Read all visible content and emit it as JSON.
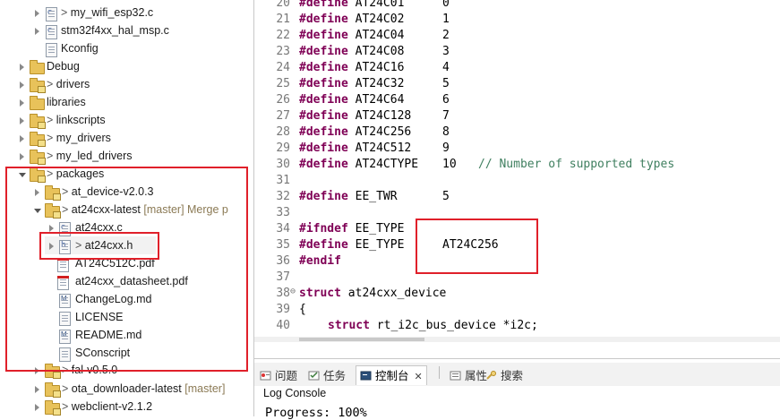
{
  "explorer": {
    "items": [
      {
        "label": "my_wifi_esp32.c",
        "prefix": "> "
      },
      {
        "label": "stm32f4xx_hal_msp.c",
        "prefix": ""
      },
      {
        "label": "Kconfig",
        "prefix": ""
      },
      {
        "label": "Debug",
        "prefix": ""
      },
      {
        "label": "drivers",
        "prefix": "> "
      },
      {
        "label": "libraries",
        "prefix": ""
      },
      {
        "label": "linkscripts",
        "prefix": "> "
      },
      {
        "label": "my_drivers",
        "prefix": "> "
      },
      {
        "label": "my_led_drivers",
        "prefix": "> "
      },
      {
        "label": "packages",
        "prefix": "> "
      },
      {
        "label": "at_device-v2.0.3",
        "prefix": "> "
      },
      {
        "label": "at24cxx-latest",
        "prefix": "> ",
        "branch": "[master] Merge p"
      },
      {
        "label": "at24cxx.c",
        "prefix": ""
      },
      {
        "label": "at24cxx.h",
        "prefix": "> "
      },
      {
        "label": "AT24C512C.pdf",
        "prefix": ""
      },
      {
        "label": "at24cxx_datasheet.pdf",
        "prefix": ""
      },
      {
        "label": "ChangeLog.md",
        "prefix": ""
      },
      {
        "label": "LICENSE",
        "prefix": ""
      },
      {
        "label": "README.md",
        "prefix": ""
      },
      {
        "label": "SConscript",
        "prefix": ""
      },
      {
        "label": "fal-v0.5.0",
        "prefix": "> "
      },
      {
        "label": "ota_downloader-latest",
        "prefix": "> ",
        "branch": "[master]"
      },
      {
        "label": "webclient-v2.1.2",
        "prefix": "> "
      }
    ]
  },
  "editor": {
    "lines": [
      {
        "n": "20",
        "kw": "#define",
        "name": "AT24C01",
        "val": "0"
      },
      {
        "n": "21",
        "kw": "#define",
        "name": "AT24C02",
        "val": "1"
      },
      {
        "n": "22",
        "kw": "#define",
        "name": "AT24C04",
        "val": "2"
      },
      {
        "n": "23",
        "kw": "#define",
        "name": "AT24C08",
        "val": "3"
      },
      {
        "n": "24",
        "kw": "#define",
        "name": "AT24C16",
        "val": "4"
      },
      {
        "n": "25",
        "kw": "#define",
        "name": "AT24C32",
        "val": "5"
      },
      {
        "n": "26",
        "kw": "#define",
        "name": "AT24C64",
        "val": "6"
      },
      {
        "n": "27",
        "kw": "#define",
        "name": "AT24C128",
        "val": "7"
      },
      {
        "n": "28",
        "kw": "#define",
        "name": "AT24C256",
        "val": "8"
      },
      {
        "n": "29",
        "kw": "#define",
        "name": "AT24C512",
        "val": "9"
      },
      {
        "n": "30",
        "kw": "#define",
        "name": "AT24CTYPE",
        "val": "10",
        "comment": "// Number of supported types"
      },
      {
        "n": "31"
      },
      {
        "n": "32",
        "kw": "#define",
        "name": "EE_TWR",
        "val": "5"
      },
      {
        "n": "33"
      },
      {
        "n": "34",
        "kw": "#ifndef",
        "name": "EE_TYPE"
      },
      {
        "n": "35",
        "kw": "#define",
        "name": "EE_TYPE",
        "val": "AT24C256"
      },
      {
        "n": "36",
        "kw": "#endif"
      },
      {
        "n": "37"
      },
      {
        "n": "38",
        "fold": "⊖",
        "kw": "struct",
        "name": "at24cxx_device"
      },
      {
        "n": "39",
        "name": "{"
      },
      {
        "n": "40",
        "kw": "struct",
        "name": "rt_i2c_bus_device *i2c;",
        "indent": true
      }
    ]
  },
  "panel": {
    "tabs": [
      {
        "label": "问题"
      },
      {
        "label": "任务"
      },
      {
        "label": "控制台",
        "close": "✕"
      },
      {
        "label": "属性"
      },
      {
        "label": "搜索"
      }
    ],
    "console_title": "Log Console",
    "console_text": "Progress: 100%"
  },
  "colors": {
    "highlight_red": "#e0202a",
    "keyword": "#7f0055",
    "comment": "#3f7f5f"
  }
}
